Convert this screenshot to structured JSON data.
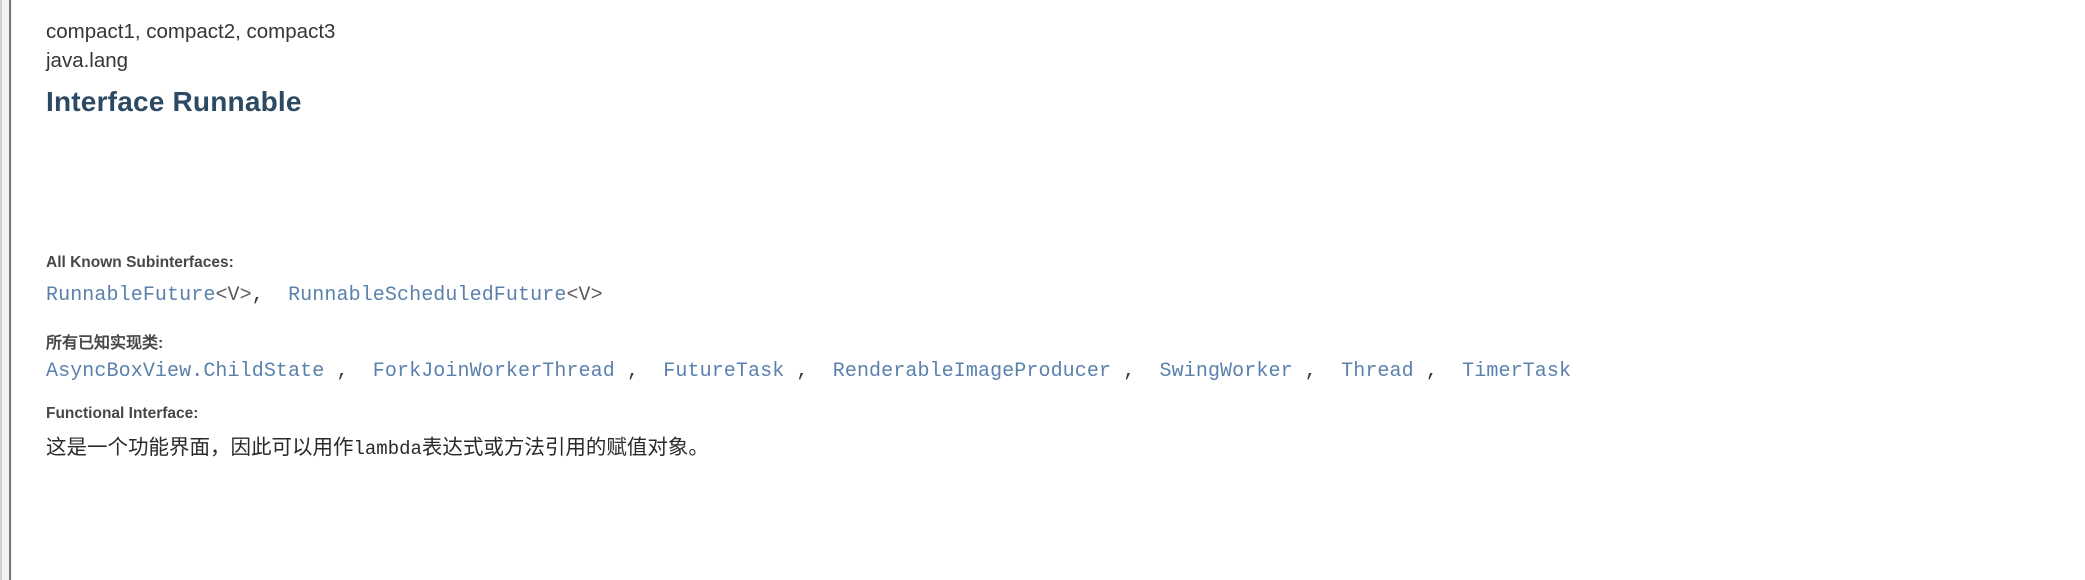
{
  "document": {
    "profiles": "compact1, compact2, compact3",
    "package": "java.lang",
    "title": "Interface Runnable"
  },
  "sections": {
    "subinterfaces": {
      "label": "All Known Subinterfaces:",
      "items": [
        {
          "name": "RunnableFuture",
          "generic": "<V>"
        },
        {
          "name": "RunnableScheduledFuture",
          "generic": "<V>"
        }
      ],
      "separator": ","
    },
    "implementing_classes": {
      "label": "所有已知实现类:",
      "items": [
        "AsyncBoxView.ChildState",
        "ForkJoinWorkerThread",
        "FutureTask",
        "RenderableImageProducer",
        "SwingWorker",
        "Thread",
        "TimerTask"
      ],
      "separator": ","
    },
    "functional_interface": {
      "label": "Functional Interface:",
      "description_prefix": "这是一个功能界面，因此可以用作",
      "description_mono": "lambda",
      "description_suffix": "表达式或方法引用的赋值对象。"
    }
  },
  "colors": {
    "title": "#2c4a63",
    "link": "#5a81ad",
    "label": "#474747",
    "body": "#2a2a2a",
    "background": "#ffffff",
    "gutter": "#f2f2f2"
  }
}
